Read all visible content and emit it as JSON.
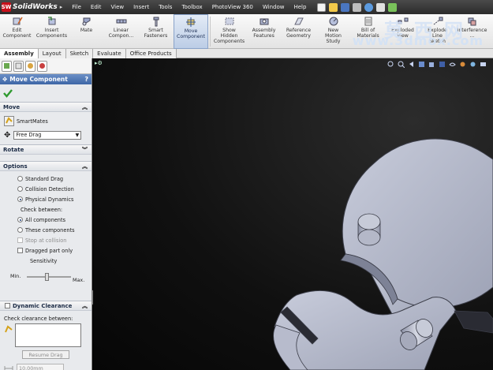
{
  "app": {
    "logo_letter": "SW",
    "name": "SolidWorks"
  },
  "menu": [
    "File",
    "Edit",
    "View",
    "Insert",
    "Tools",
    "Toolbox",
    "PhotoView 360",
    "Window",
    "Help"
  ],
  "ribbon": [
    {
      "id": "edit-component",
      "label": "Edit\nComponent",
      "icon": "edit-component-icon"
    },
    {
      "id": "insert-components",
      "label": "Insert\nComponents",
      "icon": "insert-components-icon"
    },
    {
      "id": "mate",
      "label": "Mate",
      "icon": "mate-icon"
    },
    {
      "id": "linear-component",
      "label": "Linear\nCompon...",
      "icon": "linear-pattern-icon"
    },
    {
      "id": "smart-fasteners",
      "label": "Smart\nFasteners",
      "icon": "fastener-icon"
    },
    {
      "id": "move-component",
      "label": "Move\nComponent",
      "icon": "move-component-icon",
      "active": true
    },
    {
      "id": "show-hidden",
      "label": "Show\nHidden\nComponents",
      "icon": "show-hidden-icon"
    },
    {
      "id": "assembly-features",
      "label": "Assembly\nFeatures",
      "icon": "assembly-features-icon"
    },
    {
      "id": "reference-geometry",
      "label": "Reference\nGeometry",
      "icon": "reference-geometry-icon"
    },
    {
      "id": "new-motion-study",
      "label": "New\nMotion\nStudy",
      "icon": "motion-study-icon"
    },
    {
      "id": "bill-of-materials",
      "label": "Bill of\nMaterials",
      "icon": "bom-icon"
    },
    {
      "id": "exploded-view",
      "label": "Exploded\nView",
      "icon": "exploded-view-icon"
    },
    {
      "id": "explode-line-sketch",
      "label": "Explode\nLine\nSketch",
      "icon": "explode-line-icon"
    },
    {
      "id": "interference",
      "label": "Interference\n...",
      "icon": "interference-icon"
    }
  ],
  "watermark": {
    "cn": "莫西网",
    "url": "www.3dmox.com"
  },
  "tabs": [
    {
      "label": "Assembly",
      "active": true
    },
    {
      "label": "Layout"
    },
    {
      "label": "Sketch"
    },
    {
      "label": "Evaluate"
    },
    {
      "label": "Office Products"
    }
  ],
  "panel": {
    "title": "Move Component",
    "help": "?",
    "move": {
      "heading": "Move",
      "smartmates": "SmartMates",
      "drag_mode": "Free Drag"
    },
    "rotate": {
      "heading": "Rotate"
    },
    "options": {
      "heading": "Options",
      "standard_drag": "Standard Drag",
      "collision_detection": "Collision Detection",
      "physical_dynamics": "Physical Dynamics",
      "check_between": "Check between:",
      "all_components": "All components",
      "these_components": "These components",
      "stop_at_collision": "Stop at collision",
      "dragged_part_only": "Dragged part only",
      "sensitivity": "Sensitivity",
      "min": "Min.",
      "max": "Max.",
      "sensitivity_value": 0.45
    },
    "dynamic_clearance": {
      "heading": "Dynamic Clearance",
      "check_clearance": "Check clearance between:",
      "resume_drag": "Resume Drag",
      "clearance_value": "10.00mm"
    }
  },
  "colors": {
    "accent": "#3d66a6",
    "part_face": "#aeb3c5",
    "part_edge": "#3b3d48",
    "watermark": "#d2e1f5"
  }
}
